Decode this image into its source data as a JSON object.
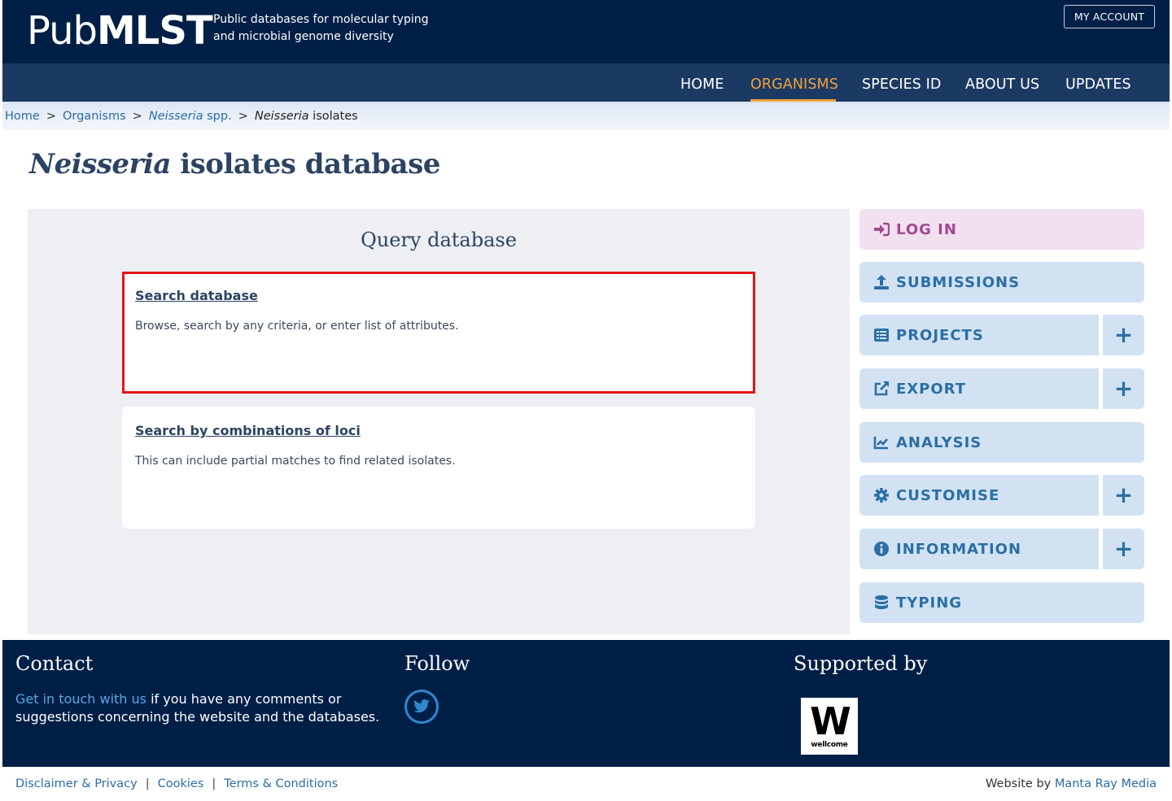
{
  "header": {
    "logo_light": "Pub",
    "logo_bold": "MLST",
    "tagline_line1": "Public databases for molecular typing",
    "tagline_line2": "and microbial genome diversity",
    "account_button": "MY ACCOUNT"
  },
  "nav": {
    "items": [
      "HOME",
      "ORGANISMS",
      "SPECIES ID",
      "ABOUT US",
      "UPDATES"
    ],
    "active": "ORGANISMS"
  },
  "breadcrumb": {
    "home": "Home",
    "organisms": "Organisms",
    "genus_italic": "Neisseria",
    "genus_suffix": "spp.",
    "current_italic": "Neisseria",
    "current_suffix": "isolates",
    "separator": ">"
  },
  "page_title": {
    "italic": "Neisseria",
    "rest": "isolates database"
  },
  "query_panel": {
    "title": "Query database",
    "cards": [
      {
        "title": "Search database",
        "description": "Browse, search by any criteria, or enter list of attributes."
      },
      {
        "title": "Search by combinations of loci",
        "description": "This can include partial matches to find related isolates."
      }
    ]
  },
  "sidebar": {
    "items": [
      {
        "label": "LOG IN",
        "icon": "sign-in-icon",
        "expandable": false
      },
      {
        "label": "SUBMISSIONS",
        "icon": "upload-icon",
        "expandable": false
      },
      {
        "label": "PROJECTS",
        "icon": "list-icon",
        "expandable": true
      },
      {
        "label": "EXPORT",
        "icon": "external-link-icon",
        "expandable": true
      },
      {
        "label": "ANALYSIS",
        "icon": "line-chart-icon",
        "expandable": false
      },
      {
        "label": "CUSTOMISE",
        "icon": "gear-icon",
        "expandable": true
      },
      {
        "label": "INFORMATION",
        "icon": "info-icon",
        "expandable": true
      },
      {
        "label": "TYPING",
        "icon": "database-icon",
        "expandable": false
      }
    ],
    "expand_symbol": "+"
  },
  "footer": {
    "contact_heading": "Contact",
    "contact_link": "Get in touch with us",
    "contact_text": " if you have any comments or suggestions concerning the website and the databases.",
    "follow_heading": "Follow",
    "supported_heading": "Supported by",
    "supporter_logo_letter": "W",
    "supporter_logo_text": "wellcome"
  },
  "bottom_links": [
    "Disclaimer & Privacy",
    "Cookies",
    "Terms & Conditions"
  ],
  "bottom_separator": "|",
  "credit": {
    "prefix": "Website by ",
    "link": "Manta Ray Media"
  },
  "colors": {
    "header_bg": "#001f47",
    "nav_bg": "#1b3a63",
    "nav_active": "#f1a23a",
    "sidebar_bg": "#d2e2f3",
    "login_bg": "#f1e1f0",
    "highlight_border": "#e31414"
  }
}
